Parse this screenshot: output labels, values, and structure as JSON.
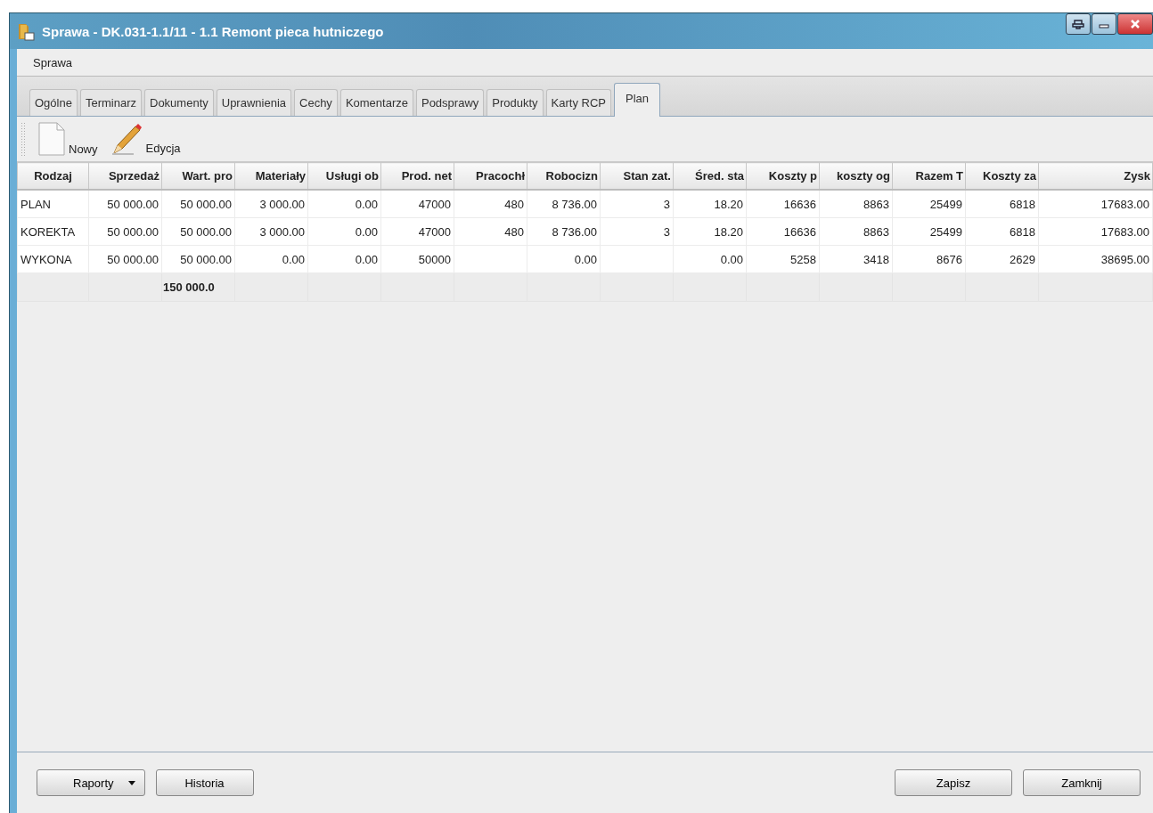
{
  "window": {
    "title": "Sprawa - DK.031-1.1/11 - 1.1 Remont pieca hutniczego"
  },
  "menu": [
    "Sprawa"
  ],
  "tabs": [
    {
      "label": "Ogólne",
      "selected": false
    },
    {
      "label": "Terminarz",
      "selected": false
    },
    {
      "label": "Dokumenty",
      "selected": false
    },
    {
      "label": "Uprawnienia",
      "selected": false
    },
    {
      "label": "Cechy",
      "selected": false
    },
    {
      "label": "Komentarze",
      "selected": false
    },
    {
      "label": "Podsprawy",
      "selected": false
    },
    {
      "label": "Produkty",
      "selected": false
    },
    {
      "label": "Karty RCP",
      "selected": false
    },
    {
      "label": "Plan",
      "selected": true
    }
  ],
  "toolbar": [
    {
      "kind": "new",
      "label": "Nowy"
    },
    {
      "kind": "edit",
      "label": "Edycja"
    }
  ],
  "table": {
    "columns": [
      "Rodzaj",
      "Sprzedaż",
      "Wart. pro",
      "Materiały",
      "Usługi ob",
      "Prod. net",
      "Pracochł",
      "Robocizn",
      "Stan zat.",
      "Śred. sta",
      "Koszty p",
      "koszty og",
      "Razem T",
      "Koszty za",
      "Zysk"
    ],
    "rows": [
      [
        "PLAN",
        "50 000.00",
        "50 000.00",
        "3 000.00",
        "0.00",
        "47000",
        "480",
        "8 736.00",
        "3",
        "18.20",
        "16636",
        "8863",
        "25499",
        "6818",
        "17683.00"
      ],
      [
        "KOREKTA",
        "50 000.00",
        "50 000.00",
        "3 000.00",
        "0.00",
        "47000",
        "480",
        "8 736.00",
        "3",
        "18.20",
        "16636",
        "8863",
        "25499",
        "6818",
        "17683.00"
      ],
      [
        "WYKONA",
        "50 000.00",
        "50 000.00",
        "0.00",
        "0.00",
        "50000",
        "",
        "0.00",
        "",
        "0.00",
        "5258",
        "3418",
        "8676",
        "2629",
        "38695.00"
      ]
    ],
    "totals": {
      "sum": "150 000.0"
    }
  },
  "buttons_left": [
    {
      "label": "Raporty",
      "kind": "dropdown"
    },
    {
      "label": "Historia",
      "kind": "plain"
    }
  ],
  "buttons_right": [
    "Zapisz",
    "Zamknij"
  ]
}
